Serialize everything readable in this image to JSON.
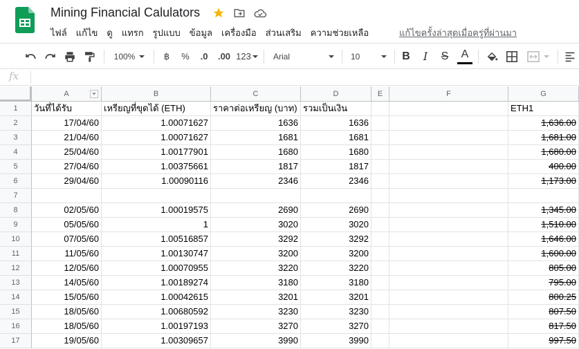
{
  "document": {
    "title": "Mining Financial Calulators",
    "last_edit": "แก้ไขครั้งล่าสุดเมื่อครู่ที่ผ่านมา"
  },
  "menu": [
    "ไฟล์",
    "แก้ไข",
    "ดู",
    "แทรก",
    "รูปแบบ",
    "ข้อมูล",
    "เครื่องมือ",
    "ส่วนเสริม",
    "ความช่วยเหลือ"
  ],
  "toolbar": {
    "zoom": "100%",
    "currency": "฿",
    "percent": "%",
    "dec_decrease": ".0",
    "dec_increase": ".00",
    "more_formats": "123",
    "font": "Arial",
    "font_size": "10",
    "bold": "B",
    "italic": "I",
    "strike": "S",
    "text_color_letter": "A"
  },
  "formula_bar": {
    "fx": "fx",
    "value": ""
  },
  "columns": [
    "A",
    "B",
    "C",
    "D",
    "E",
    "F",
    "G"
  ],
  "rows": [
    {
      "n": "1",
      "a": "วันที่ได้รับ",
      "b": "เหรียญที่ขุดได้ (ETH)",
      "c": "ราคาต่อเหรียญ (บาท)",
      "d": "รวมเป็นเงิน",
      "g": "ETH1",
      "header": true
    },
    {
      "n": "2",
      "a": "17/04/60",
      "b": "1.00071627",
      "c": "1636",
      "d": "1636",
      "g": "1,636.00"
    },
    {
      "n": "3",
      "a": "21/04/60",
      "b": "1.00071627",
      "c": "1681",
      "d": "1681",
      "g": "1,681.00"
    },
    {
      "n": "4",
      "a": "25/04/60",
      "b": "1.00177901",
      "c": "1680",
      "d": "1680",
      "g": "1,680.00"
    },
    {
      "n": "5",
      "a": "27/04/60",
      "b": "1.00375661",
      "c": "1817",
      "d": "1817",
      "g": "400.00"
    },
    {
      "n": "6",
      "a": "29/04/60",
      "b": "1.00090116",
      "c": "2346",
      "d": "2346",
      "g": "1,173.00"
    },
    {
      "n": "7",
      "a": "",
      "b": "",
      "c": "",
      "d": "",
      "g": ""
    },
    {
      "n": "8",
      "a": "02/05/60",
      "b": "1.00019575",
      "c": "2690",
      "d": "2690",
      "g": "1,345.00"
    },
    {
      "n": "9",
      "a": "05/05/60",
      "b": "1",
      "c": "3020",
      "d": "3020",
      "g": "1,510.00"
    },
    {
      "n": "10",
      "a": "07/05/60",
      "b": "1.00516857",
      "c": "3292",
      "d": "3292",
      "g": "1,646.00"
    },
    {
      "n": "11",
      "a": "11/05/60",
      "b": "1.00130747",
      "c": "3200",
      "d": "3200",
      "g": "1,600.00"
    },
    {
      "n": "12",
      "a": "12/05/60",
      "b": "1.00070955",
      "c": "3220",
      "d": "3220",
      "g": "805.00"
    },
    {
      "n": "13",
      "a": "14/05/60",
      "b": "1.00189274",
      "c": "3180",
      "d": "3180",
      "g": "795.00"
    },
    {
      "n": "14",
      "a": "15/05/60",
      "b": "1.00042615",
      "c": "3201",
      "d": "3201",
      "g": "800.25"
    },
    {
      "n": "15",
      "a": "18/05/60",
      "b": "1.00680592",
      "c": "3230",
      "d": "3230",
      "g": "807.50"
    },
    {
      "n": "16",
      "a": "18/05/60",
      "b": "1.00197193",
      "c": "3270",
      "d": "3270",
      "g": "817.50"
    },
    {
      "n": "17",
      "a": "19/05/60",
      "b": "1.00309657",
      "c": "3990",
      "d": "3990",
      "g": "997.50"
    }
  ],
  "colors": {
    "sheets_green": "#0f9d58",
    "star": "#f4b400",
    "header_bg": "#f8f9fa",
    "text_color_bar": "#000000"
  }
}
